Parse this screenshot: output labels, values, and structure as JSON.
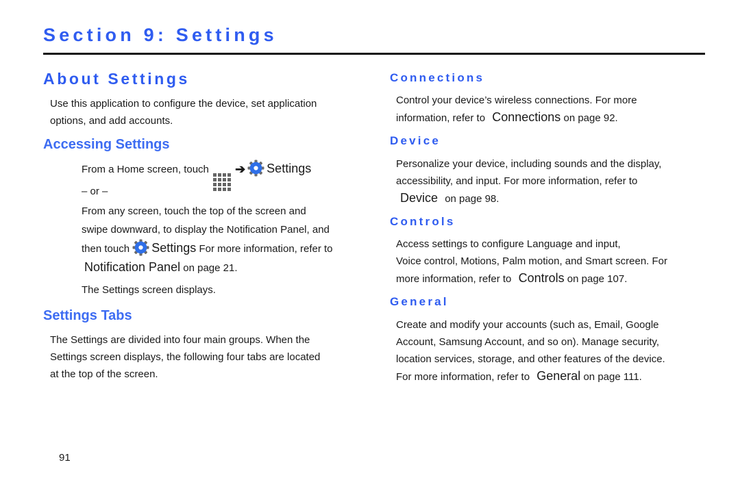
{
  "header": {
    "section_title": "Section 9: Settings"
  },
  "left": {
    "about_heading": "About Settings",
    "about_text": [
      "Use this application to configure the device, set application",
      "options, and add accounts."
    ],
    "accessing": {
      "heading": "Accessing Settings",
      "step1_prefix": "From a Home screen, touch",
      "step1_apps_icon": "apps-grid-icon",
      "step1_arrow": "➔",
      "step1_settings_icon": "settings-gear-icon",
      "step1_settings_label": "Settings",
      "or_text": "– or –",
      "step2_lines": [
        "From any screen, touch the top of the screen and",
        "swipe downward, to display the Notification Panel, and"
      ],
      "step2_then": "then touch",
      "step2_settings_icon": "settings-gear-icon",
      "step2_settings_label": "Settings",
      "step2_more": "For more information, refer to",
      "step2_ref": "Notification Panel",
      "step2_ref_page": "on page 21.",
      "result": "The Settings screen displays."
    },
    "tabs_section": {
      "heading": "Settings Tabs",
      "text": [
        "The Settings are divided into four main groups. When the",
        "Settings screen displays, the following four tabs are located",
        "at the top of the screen."
      ]
    }
  },
  "right": {
    "connections": {
      "heading": "Connections",
      "line1": "Control your device’s wireless connections. For more",
      "line2_prefix": "information, refer to",
      "ref": "Connections",
      "ref_page": "on page 92."
    },
    "device": {
      "heading": "Device",
      "line1": "Personalize your device, including sounds and the display,",
      "line2": "accessibility, and input. For more information, refer to",
      "ref": "Device",
      "ref_page": "on page 98."
    },
    "controls": {
      "heading": "Controls",
      "line1": "Access settings to configure Language and input,",
      "line2": "Voice control, Motions, Palm motion, and Smart screen. For",
      "line3_prefix": "more information, refer to",
      "ref": "Controls",
      "ref_page": "on page 107."
    },
    "general": {
      "heading": "General",
      "line1": "Create and modify your accounts (such as, Email, Google",
      "line2": "Account, Samsung Account, and so on). Manage security,",
      "line3": "location services, storage, and other features of the device.",
      "line4_prefix": "For more information, refer to",
      "ref": "General",
      "ref_page": "on page 111."
    }
  },
  "footer": {
    "page_number": "91"
  },
  "colors": {
    "heading_blue": "#2f5cf0",
    "subheading_blue": "#3d6cf2",
    "gear_blue": "#2f6fe8",
    "gear_gray": "#6b6b6b",
    "rule": "#111111",
    "body_text": "#1a1a1a"
  }
}
